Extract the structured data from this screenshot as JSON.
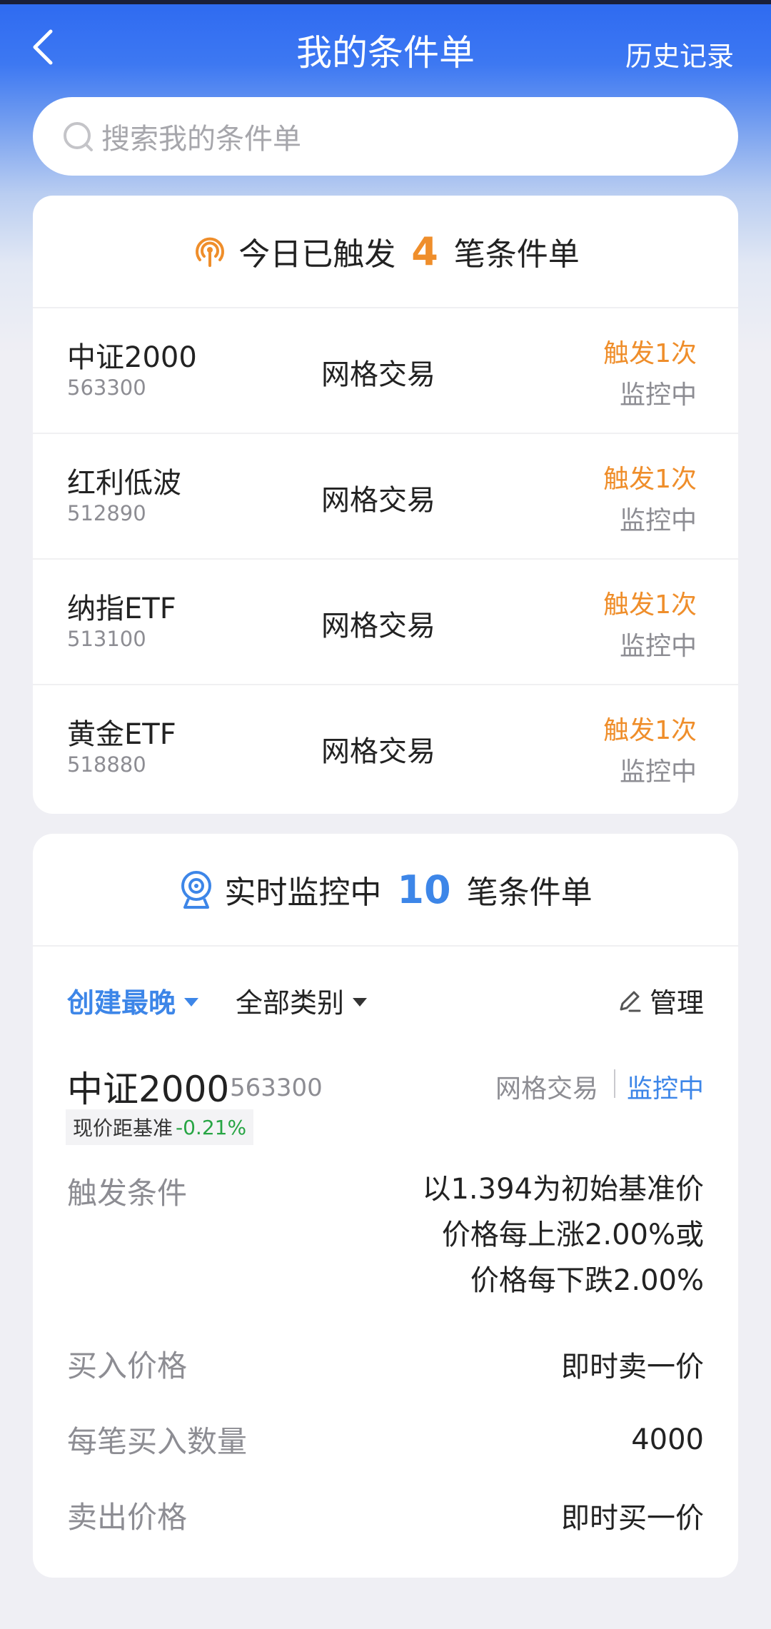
{
  "header": {
    "title": "我的条件单",
    "history_label": "历史记录"
  },
  "search": {
    "placeholder": "搜索我的条件单"
  },
  "today_card": {
    "prefix": "今日已触发",
    "count": "4",
    "suffix": "笔条件单",
    "rows": [
      {
        "name": "中证2000",
        "code": "563300",
        "type": "网格交易",
        "trigger": "触发1次",
        "status": "监控中"
      },
      {
        "name": "红利低波",
        "code": "512890",
        "type": "网格交易",
        "trigger": "触发1次",
        "status": "监控中"
      },
      {
        "name": "纳指ETF",
        "code": "513100",
        "type": "网格交易",
        "trigger": "触发1次",
        "status": "监控中"
      },
      {
        "name": "黄金ETF",
        "code": "518880",
        "type": "网格交易",
        "trigger": "触发1次",
        "status": "监控中"
      }
    ]
  },
  "monitor_card": {
    "prefix": "实时监控中",
    "count": "10",
    "suffix": "笔条件单",
    "sort_label": "创建最晚",
    "category_label": "全部类别",
    "manage_label": "管理",
    "order": {
      "name": "中证2000",
      "code": "563300",
      "type": "网格交易",
      "status": "监控中",
      "distance_label": "现价距基准",
      "distance_value": "-0.21%",
      "condition_label": "触发条件",
      "condition_lines": [
        "以1.394为初始基准价",
        "价格每上涨2.00%或",
        "价格每下跌2.00%"
      ],
      "buy_price_label": "买入价格",
      "buy_price_value": "即时卖一价",
      "qty_label": "每笔买入数量",
      "qty_value": "4000",
      "sell_price_label": "卖出价格",
      "sell_price_value": "即时买一价"
    }
  },
  "colors": {
    "header_blue": "#2f6bf1",
    "orange": "#ef8e2b",
    "blue": "#3d86e8",
    "green": "#27a544"
  }
}
